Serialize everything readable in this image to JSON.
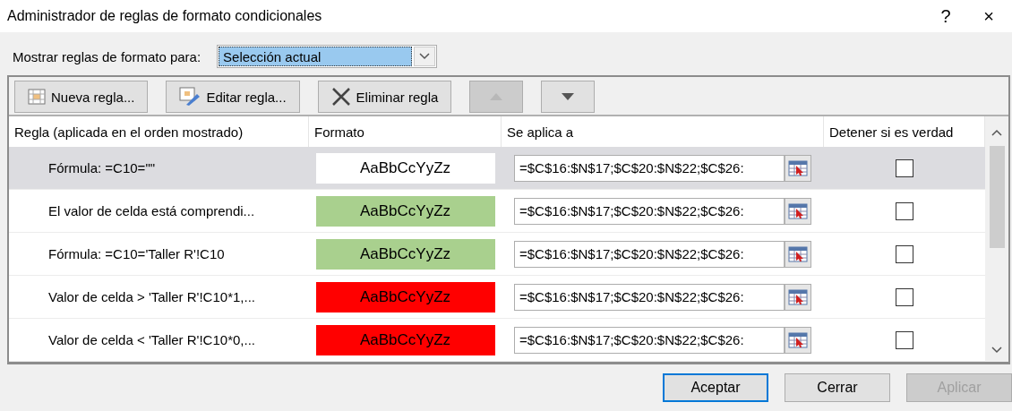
{
  "window": {
    "title": "Administrador de reglas de formato condicionales",
    "help": "?",
    "close": "×"
  },
  "show_rules": {
    "label": "Mostrar reglas de formato para:",
    "value": "Selección actual"
  },
  "toolbar": [
    {
      "kind": "new",
      "label": "Nueva regla...",
      "disabled": false
    },
    {
      "kind": "edit",
      "label": "Editar regla...",
      "disabled": false
    },
    {
      "kind": "delete",
      "label": "Eliminar regla",
      "disabled": false
    },
    {
      "kind": "up",
      "disabled": true
    },
    {
      "kind": "down",
      "disabled": false
    }
  ],
  "table": {
    "columns": [
      "Regla (aplicada en el orden mostrado)",
      "Formato",
      "Se aplica a",
      "Detener si es verdad"
    ],
    "rows": [
      {
        "rule": "Fórmula: =C10=\"\"",
        "format": "AaBbCcYyZz",
        "color": "#ffffff",
        "applies_to": "=$C$16:$N$17;$C$20:$N$22;$C$26:",
        "stop": false,
        "selected": true
      },
      {
        "rule": "El valor de celda está comprendi...",
        "format": "AaBbCcYyZz",
        "color": "#a9d08e",
        "applies_to": "=$C$16:$N$17;$C$20:$N$22;$C$26:",
        "stop": false,
        "selected": false
      },
      {
        "rule": "Fórmula: =C10='Taller R'!C10",
        "format": "AaBbCcYyZz",
        "color": "#a9d08e",
        "applies_to": "=$C$16:$N$17;$C$20:$N$22;$C$26:",
        "stop": false,
        "selected": false
      },
      {
        "rule": "Valor de celda > 'Taller R'!C10*1,...",
        "format": "AaBbCcYyZz",
        "color": "#ff0000",
        "applies_to": "=$C$16:$N$17;$C$20:$N$22;$C$26:",
        "stop": false,
        "selected": false
      },
      {
        "rule": "Valor de celda < 'Taller R'!C10*0,...",
        "format": "AaBbCcYyZz",
        "color": "#ff0000",
        "applies_to": "=$C$16:$N$17;$C$20:$N$22;$C$26:",
        "stop": false,
        "selected": false
      }
    ]
  },
  "buttons": [
    {
      "label": "Aceptar",
      "default": true,
      "disabled": false
    },
    {
      "label": "Cerrar",
      "default": false,
      "disabled": false
    },
    {
      "label": "Aplicar",
      "default": false,
      "disabled": true
    }
  ]
}
